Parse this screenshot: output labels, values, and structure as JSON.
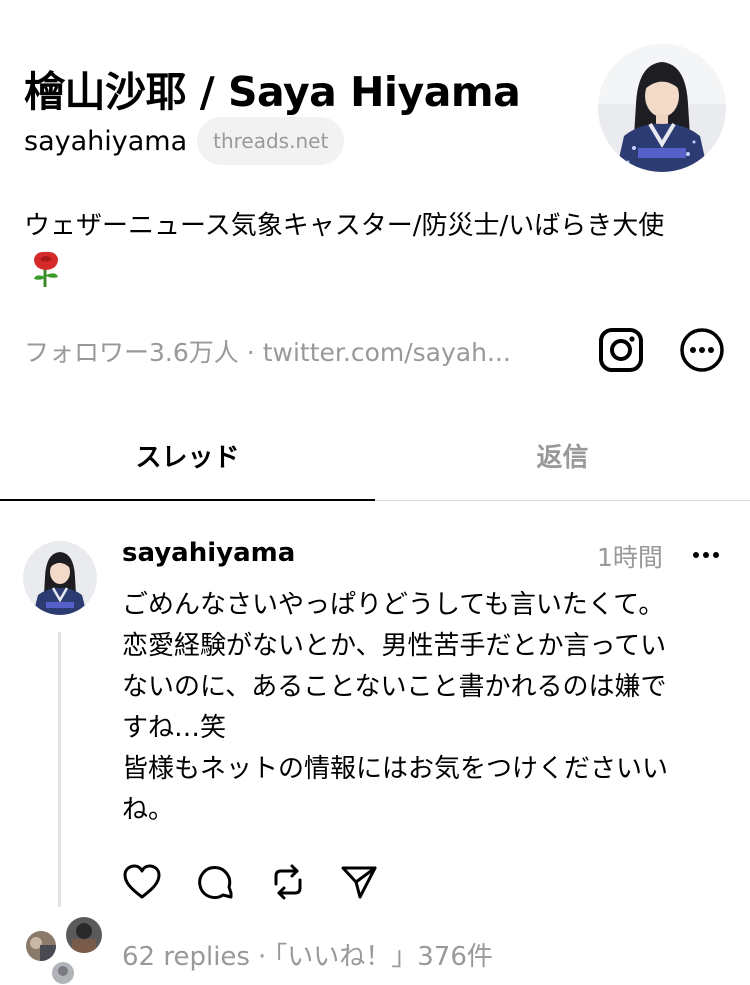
{
  "profile": {
    "name": "檜山沙耶 / Saya Hiyama",
    "handle": "sayahiyama",
    "domain_badge": "threads.net",
    "bio": "ウェザーニュース気象キャスター/防災士/いばらき大使",
    "bio_emoji": "rose-icon",
    "followers": "フォロワー3.6万人",
    "separator": "·",
    "link": "twitter.com/sayah..."
  },
  "tabs": [
    {
      "label": "スレッド",
      "active": true
    },
    {
      "label": "返信",
      "active": false
    }
  ],
  "post": {
    "username": "sayahiyama",
    "time": "1時間",
    "lines": [
      "ごめんなさいやっぱりどうしても言いたくて。",
      "恋愛経験がないとか、男性苦手だとか言ってい",
      "ないのに、あることないこと書かれるのは嫌で",
      "すね…笑",
      "皆様もネットの情報にはお気をつけくださいい",
      "ね。"
    ],
    "replies": "62 replies",
    "dot": "·",
    "likes": "「いいね！」376件"
  },
  "icons": {
    "instagram": "instagram-icon",
    "more": "more-icon",
    "like": "heart-icon",
    "comment": "comment-icon",
    "repost": "repost-icon",
    "share": "send-icon"
  },
  "colors": {
    "text": "#000000",
    "muted": "#999999",
    "badge_bg": "#f2f2f2",
    "divider": "#dcdcdc",
    "kimono": "#2c3c72"
  }
}
